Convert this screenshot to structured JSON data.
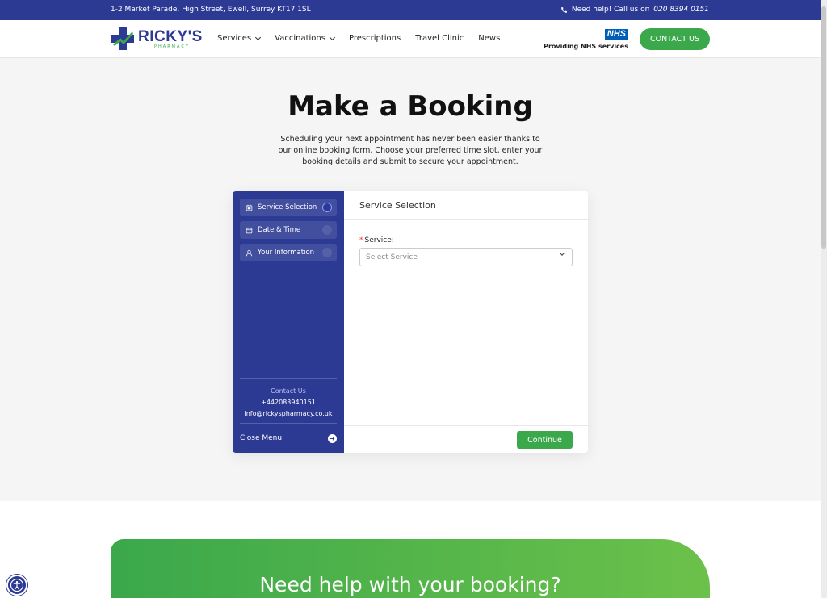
{
  "topbar": {
    "address": "1-2 Market Parade, High Street, Ewell, Surrey KT17 1SL",
    "help_text": "Need help! Call us on",
    "help_phone": "020 8394 0151"
  },
  "header": {
    "logo_main": "RICKY'S",
    "logo_sub": "PHARMACY",
    "nav": [
      {
        "label": "Services"
      },
      {
        "label": "Vaccinations"
      },
      {
        "label": "Prescriptions"
      },
      {
        "label": "Travel Clinic"
      },
      {
        "label": "News"
      }
    ],
    "nhs_badge": "NHS",
    "nhs_text": "Providing NHS services",
    "contact_label": "CONTACT US"
  },
  "hero": {
    "title": "Make a Booking",
    "description": "Scheduling your next appointment has never been easier thanks to our online booking form. Choose your preferred time slot, enter your booking details and submit to secure your appointment."
  },
  "booking": {
    "steps": [
      {
        "label": "Service Selection",
        "icon": "calendar-check-icon",
        "active": true
      },
      {
        "label": "Date & Time",
        "icon": "calendar-icon",
        "active": false
      },
      {
        "label": "Your Information",
        "icon": "user-icon",
        "active": false
      }
    ],
    "contact_label": "Contact Us",
    "contact_phone": "+442083940151",
    "contact_email": "info@rickyspharmacy.co.uk",
    "close_menu": "Close Menu",
    "panel_title": "Service Selection",
    "service_label": "Service:",
    "service_placeholder": "Select Service",
    "continue_label": "Continue"
  },
  "lower": {
    "headline": "Need help with your booking?"
  },
  "colors": {
    "brand_blue": "#2d3a94",
    "brand_green": "#3aa84b"
  }
}
